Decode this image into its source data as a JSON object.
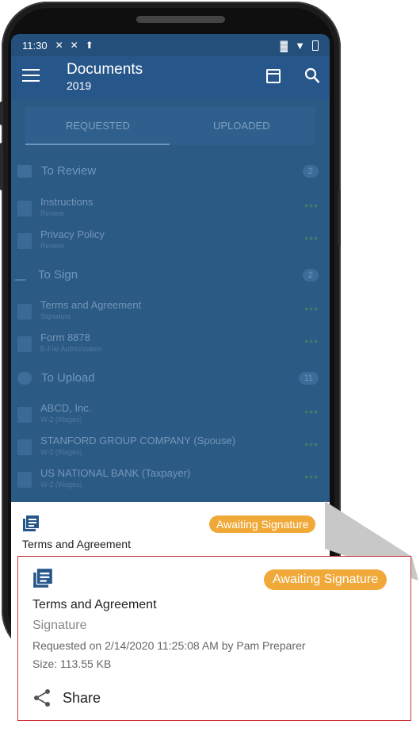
{
  "status_bar": {
    "time": "11:30"
  },
  "app_bar": {
    "title": "Documents",
    "subtitle": "2019"
  },
  "tabs": [
    {
      "label": "REQUESTED"
    },
    {
      "label": "UPLOADED"
    }
  ],
  "sections": {
    "review": {
      "title": "To Review",
      "count": "2",
      "items": [
        {
          "name": "Instructions",
          "meta": "Review"
        },
        {
          "name": "Privacy Policy",
          "meta": "Review"
        }
      ]
    },
    "sign": {
      "title": "To Sign",
      "count": "2",
      "items": [
        {
          "name": "Terms and Agreement",
          "meta": "Signature"
        },
        {
          "name": "Form 8878",
          "meta": "E-File Authorization"
        }
      ]
    },
    "upload": {
      "title": "To Upload",
      "count": "11",
      "items": [
        {
          "name": "ABCD, Inc.",
          "meta": "W-2 (Wages)"
        },
        {
          "name": "STANFORD GROUP COMPANY (Spouse)",
          "meta": "W-2 (Wages)"
        },
        {
          "name": "US NATIONAL BANK (Taxpayer)",
          "meta": "W-2 (Wages)"
        }
      ]
    }
  },
  "sheet": {
    "badge": "Awaiting Signature",
    "title": "Terms and Agreement"
  },
  "detail": {
    "badge": "Awaiting Signature",
    "title": "Terms and Agreement",
    "subtitle": "Signature",
    "requested": "Requested on 2/14/2020 11:25:08 AM by Pam Preparer",
    "size": "Size: 113.55 KB",
    "share_label": "Share"
  },
  "colors": {
    "accent": "#27578a",
    "badge": "#f0a939",
    "highlight_border": "#c9353b"
  }
}
